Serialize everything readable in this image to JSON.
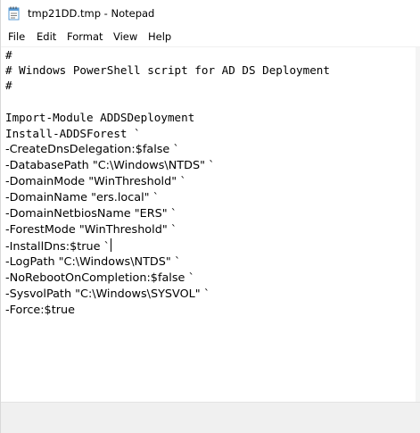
{
  "window": {
    "title": "tmp21DD.tmp - Notepad",
    "app_icon": "notepad-icon"
  },
  "menu": {
    "file": "File",
    "edit": "Edit",
    "format": "Format",
    "view": "View",
    "help": "Help"
  },
  "editor": {
    "lines": [
      "#",
      "# Windows PowerShell script for AD DS Deployment",
      "#",
      "",
      "Import-Module ADDSDeployment",
      "Install-ADDSForest `",
      "-CreateDnsDelegation:$false `",
      "-DatabasePath \"C:\\Windows\\NTDS\" `",
      "-DomainMode \"WinThreshold\" `",
      "-DomainName \"ers.local\" `",
      "-DomainNetbiosName \"ERS\" `",
      "-ForestMode \"WinThreshold\" `",
      "-InstallDns:$true `",
      "-LogPath \"C:\\Windows\\NTDS\" `",
      "-NoRebootOnCompletion:$false `",
      "-SysvolPath \"C:\\Windows\\SYSVOL\" `",
      "-Force:$true"
    ]
  }
}
